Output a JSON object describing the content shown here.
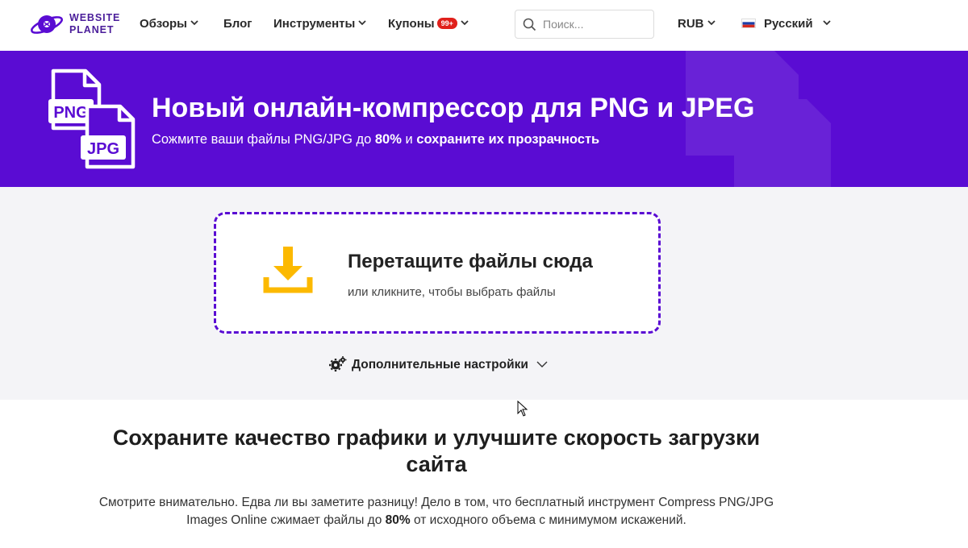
{
  "header": {
    "logo": {
      "line1": "WEBSITE",
      "line2": "PLANET"
    },
    "nav": [
      {
        "label": "Обзоры",
        "has_dropdown": true
      },
      {
        "label": "Блог",
        "has_dropdown": false
      },
      {
        "label": "Инструменты",
        "has_dropdown": true
      },
      {
        "label": "Купоны",
        "badge": "99+",
        "has_dropdown": true
      }
    ],
    "search": {
      "placeholder": "Поиск...",
      "value": ""
    },
    "currency": "RUB",
    "language": "Русский"
  },
  "hero": {
    "icon_labels": [
      "PNG",
      "JPG"
    ],
    "title": "Новый онлайн-компрессор для PNG и JPEG",
    "subtitle_pre": "Сожмите ваши файлы PNG/JPG до ",
    "subtitle_bold1": "80%",
    "subtitle_mid": " и ",
    "subtitle_bold2": "сохраните их прозрачность"
  },
  "upload": {
    "title": "Перетащите файлы сюда",
    "subtitle": "или кликните, чтобы выбрать файлы",
    "settings_label": "Дополнительные настройки"
  },
  "content": {
    "heading": "Сохраните качество графики и улучшите скорость загрузки сайта",
    "text_pre": "Смотрите внимательно. Едва ли вы заметите разницу! Дело в том, что бесплатный инструмент Compress PNG/JPG Images Online сжимает файлы до ",
    "text_bold": "80%",
    "text_post": " от исходного объема с минимумом искажений."
  },
  "colors": {
    "brand_purple": "#5a0cd3",
    "upload_yellow": "#fcb900",
    "badge_red": "#e0201b"
  }
}
